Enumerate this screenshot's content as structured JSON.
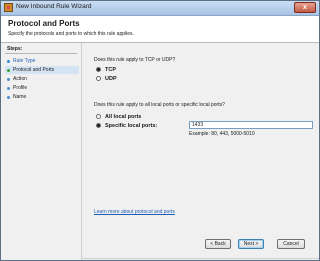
{
  "window": {
    "title": "New Inbound Rule Wizard",
    "close_label": "x"
  },
  "header": {
    "title": "Protocol and Ports",
    "subtitle": "Specify the protocols and ports to which this rule applies."
  },
  "steps": {
    "heading": "Steps:",
    "items": [
      {
        "label": "Rule Type",
        "state": "done"
      },
      {
        "label": "Protocol and Ports",
        "state": "current"
      },
      {
        "label": "Action",
        "state": "todo"
      },
      {
        "label": "Profile",
        "state": "todo"
      },
      {
        "label": "Name",
        "state": "todo"
      }
    ]
  },
  "protocol": {
    "question": "Does this rule apply to TCP or UDP?",
    "options": [
      {
        "label": "TCP",
        "selected": true
      },
      {
        "label": "UDP",
        "selected": false
      }
    ]
  },
  "ports": {
    "question": "Does this rule apply to all local ports or specific local ports?",
    "options": [
      {
        "label": "All local ports",
        "selected": false
      },
      {
        "label": "Specific local ports:",
        "selected": true
      }
    ],
    "value": "1433",
    "example": "Example: 80, 443, 5000-5010"
  },
  "link": {
    "label": "Learn more about protocol and ports"
  },
  "buttons": {
    "back": "< Back",
    "next": "Next >",
    "cancel": "Cancel"
  },
  "colors": {
    "link": "#1f5fb8",
    "selected_step_bg": "#d5e4f5"
  }
}
